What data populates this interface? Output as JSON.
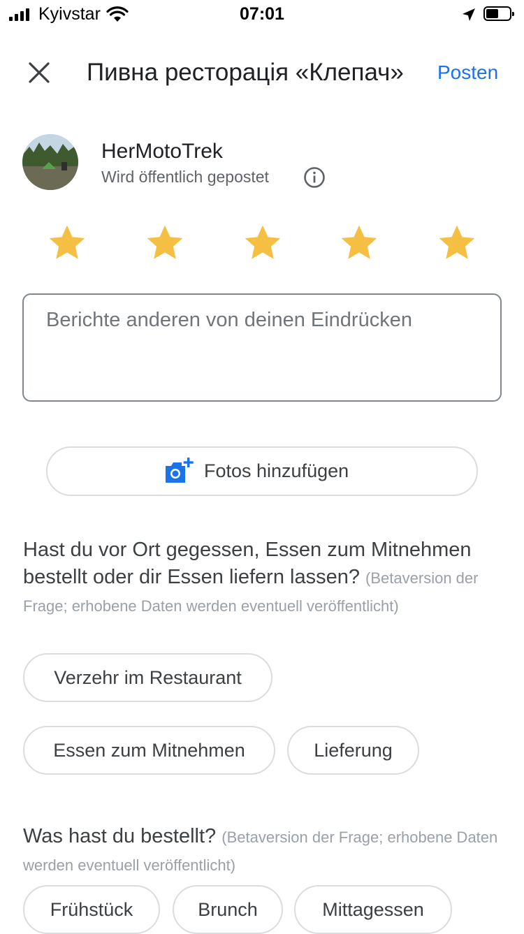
{
  "status": {
    "carrier": "Kyivstar",
    "time": "07:01"
  },
  "header": {
    "title": "Пивна ресторація «Клепач»",
    "post_label": "Posten"
  },
  "user": {
    "name": "HerMotoTrek",
    "posting_note": "Wird öffentlich gepostet"
  },
  "rating": {
    "value": 5,
    "max": 5,
    "star_color": "#f4bf42"
  },
  "review": {
    "placeholder": "Berichte anderen von deinen Eindrücken"
  },
  "photos": {
    "label": "Fotos hinzufügen"
  },
  "question1": {
    "text": "Hast du vor Ort gegessen, Essen zum Mitnehmen bestellt oder dir Essen liefern lassen?",
    "hint": "(Betaversion der Frage; erhobene Daten werden eventuell veröffentlicht)",
    "options": [
      "Verzehr im Restaurant",
      "Essen zum Mitnehmen",
      "Lieferung"
    ]
  },
  "question2": {
    "text": "Was hast du bestellt?",
    "hint": "(Betaversion der Frage; erhobene Daten werden eventuell veröffentlicht)",
    "options": [
      "Frühstück",
      "Brunch",
      "Mittagessen"
    ]
  },
  "colors": {
    "accent": "#1a73e8",
    "text": "#202124",
    "muted": "#5f6368",
    "hint": "#9aa0a6"
  }
}
